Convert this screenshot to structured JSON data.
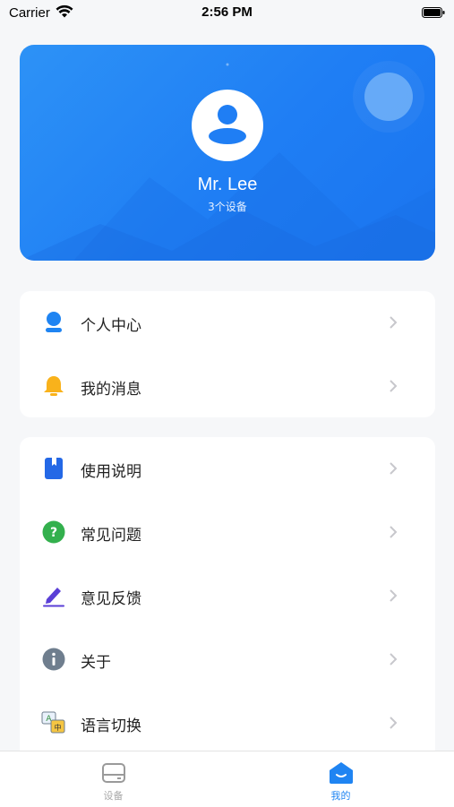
{
  "status_bar": {
    "carrier": "Carrier",
    "time": "2:56 PM"
  },
  "profile": {
    "name": "Mr. Lee",
    "device_count": "3个设备"
  },
  "menu_group_1": [
    {
      "label": "个人中心",
      "icon": "person-icon"
    },
    {
      "label": "我的消息",
      "icon": "bell-icon"
    }
  ],
  "menu_group_2": [
    {
      "label": "使用说明",
      "icon": "book-icon"
    },
    {
      "label": "常见问题",
      "icon": "question-icon"
    },
    {
      "label": "意见反馈",
      "icon": "pencil-icon"
    },
    {
      "label": "关于",
      "icon": "info-icon"
    },
    {
      "label": "语言切换",
      "icon": "language-icon"
    }
  ],
  "tab_bar": [
    {
      "label": "设备",
      "icon": "device-icon",
      "active": false
    },
    {
      "label": "我的",
      "icon": "home-mine-icon",
      "active": true
    }
  ],
  "colors": {
    "accent": "#1f84f2",
    "hero": "#1f7ef4"
  }
}
